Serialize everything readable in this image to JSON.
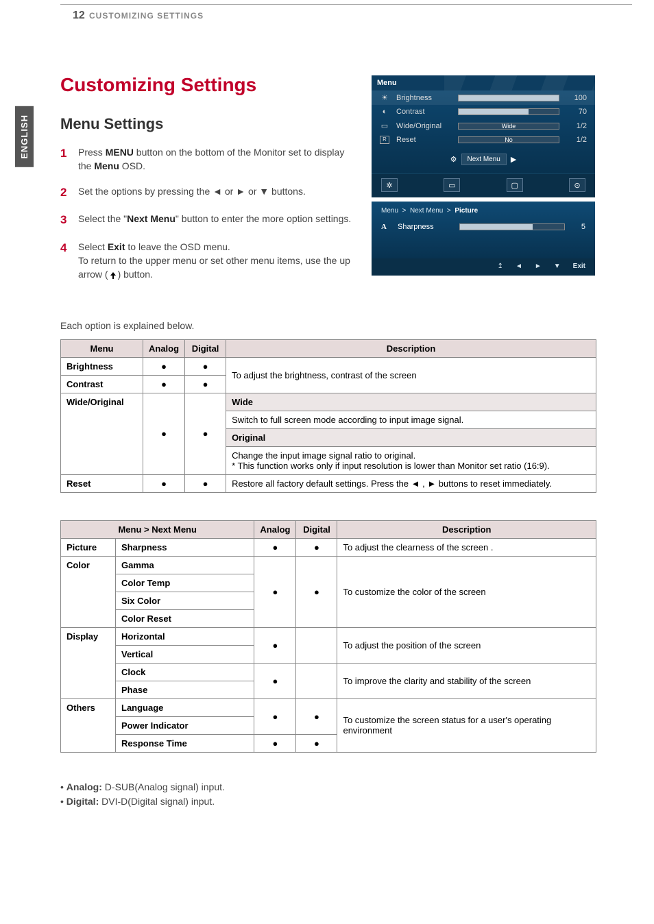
{
  "header": {
    "page_number": "12",
    "running_title": "CUSTOMIZING SETTINGS",
    "sidebar_lang": "ENGLISH"
  },
  "titles": {
    "h1": "Customizing Settings",
    "h2": "Menu Settings"
  },
  "steps": {
    "s1": {
      "num": "1",
      "pre": "Press ",
      "bold1": "MENU",
      "mid": " button on the bottom of the Monitor set to display the ",
      "bold2": "Menu",
      "post": " OSD."
    },
    "s2": {
      "num": "2",
      "text": "Set the options by pressing the ◄ or ► or ▼ buttons."
    },
    "s3": {
      "num": "3",
      "pre": "Select the \"",
      "bold": "Next Menu",
      "post": "\" button to enter the more option settings."
    },
    "s4": {
      "num": "4",
      "line1_pre": "Select ",
      "line1_bold": "Exit",
      "line1_post": " to leave the OSD menu.",
      "line2_pre": "To return to the upper menu or set other menu items, use the up arrow (",
      "line2_post": ") button."
    }
  },
  "explain": "Each option is explained below.",
  "table1": {
    "headers": {
      "menu": "Menu",
      "analog": "Analog",
      "digital": "Digital",
      "desc": "Description"
    },
    "rows": {
      "brightness": "Brightness",
      "contrast": "Contrast",
      "bc_desc": "To adjust the brightness, contrast of the screen",
      "wideorig": "Wide/Original",
      "wide": "Wide",
      "wide_desc": "Switch to full screen mode according to input image signal.",
      "original": "Original",
      "original_desc": "Change the input image signal ratio to original.\n* This function works only if input resolution is lower than Monitor set ratio (16:9).",
      "reset": "Reset",
      "reset_desc": "Restore all factory default settings. Press the ◄ , ► buttons to reset immediately."
    }
  },
  "table2": {
    "headers": {
      "menu": "Menu > Next Menu",
      "analog": "Analog",
      "digital": "Digital",
      "desc": "Description"
    },
    "rows": {
      "picture": "Picture",
      "sharpness": "Sharpness",
      "sharp_desc": "To adjust the clearness of the screen .",
      "color": "Color",
      "gamma": "Gamma",
      "ctemp": "Color Temp",
      "sixcolor": "Six Color",
      "creset": "Color Reset",
      "color_desc": "To customize the color of the screen",
      "display": "Display",
      "horizontal": "Horizontal",
      "vertical": "Vertical",
      "disp_desc": "To adjust the position of the screen",
      "clock": "Clock",
      "phase": "Phase",
      "clock_desc": "To improve the clarity and stability of the screen",
      "others": "Others",
      "language": "Language",
      "pind": "Power Indicator",
      "rtime": "Response Time",
      "others_desc": "To customize the screen status for a user's operating environment"
    }
  },
  "notes": {
    "analog_pre": "Analog:",
    "analog_val": " D-SUB(Analog signal) input.",
    "digital_pre": "Digital:",
    "digital_val": " DVI-D(Digital signal) input."
  },
  "osd": {
    "menu_label": "Menu",
    "brightness": {
      "label": "Brightness",
      "value": "100",
      "fill": "100"
    },
    "contrast": {
      "label": "Contrast",
      "value": "70",
      "fill": "70"
    },
    "wideorig": {
      "label": "Wide/Original",
      "value": "1/2",
      "text": "Wide"
    },
    "reset": {
      "label": "Reset",
      "value": "1/2",
      "text": "No"
    },
    "next_menu": "Next Menu",
    "breadcrumb": {
      "a": "Menu",
      "sep1": ">",
      "b": "Next Menu",
      "sep2": ">",
      "c": "Picture"
    },
    "sharpness": {
      "icon": "A",
      "label": "Sharpness",
      "value": "5",
      "fill": "70"
    },
    "exit": "Exit",
    "footer_icons": {
      "up": "↥",
      "left": "◄",
      "right": "►",
      "down": "▼"
    }
  }
}
